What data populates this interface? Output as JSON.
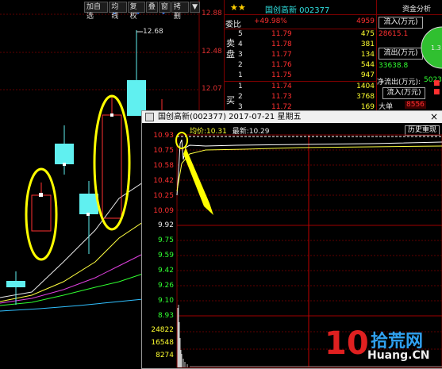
{
  "toolbar": {
    "items": [
      "加自选",
      "均线",
      "复权",
      "叠",
      "窗",
      "拷删"
    ],
    "arrow": "▼"
  },
  "main_chart": {
    "y_labels": [
      "12.88",
      "12.48",
      "12.07"
    ],
    "high_label": "12.68"
  },
  "quote": {
    "stock_name": "国创高新 002377",
    "fund_tab": "资金分析",
    "webi_label": "委比",
    "webi_value": "+49.98%",
    "webi_diff": "4959",
    "sell_side_label": "卖盘",
    "buy_side_label": "买",
    "sell_rows": [
      {
        "lvl": "5",
        "price": "11.79",
        "vol": "475"
      },
      {
        "lvl": "4",
        "price": "11.78",
        "vol": "381"
      },
      {
        "lvl": "3",
        "price": "11.77",
        "vol": "134"
      },
      {
        "lvl": "2",
        "price": "11.76",
        "vol": "544"
      },
      {
        "lvl": "1",
        "price": "11.75",
        "vol": "947"
      }
    ],
    "buy_rows": [
      {
        "lvl": "1",
        "price": "11.74",
        "vol": "1404"
      },
      {
        "lvl": "2",
        "price": "11.73",
        "vol": "3768"
      },
      {
        "lvl": "3",
        "price": "11.72",
        "vol": "169"
      }
    ],
    "inflow_label": "流入(万元)",
    "inflow_value": "28615.1",
    "outflow_label": "流出(万元)",
    "outflow_value": "33638.8",
    "net_label": "净流出(万元):",
    "net_value": "5023.7",
    "inflow2_label": "流入(万元)",
    "big_label": "大单",
    "big_value": "8556",
    "pie_value": "1.3"
  },
  "popup": {
    "title": "国创高新(002377)   2017-07-21 星期五",
    "avg_label": "均价:",
    "avg_value": "10.31",
    "latest_label": "最新:",
    "latest_value": "10.29",
    "history_button": "历史重现",
    "y_ticks": [
      "10.93",
      "10.75",
      "10.58",
      "10.42",
      "10.25",
      "10.09",
      "9.92",
      "9.75",
      "9.59",
      "9.42",
      "9.26",
      "9.10",
      "8.93"
    ],
    "vol_ticks": [
      "24822",
      "16548",
      "8274"
    ]
  },
  "watermark": {
    "number": "10",
    "brand": "拾荒网",
    "domain": "Huang.CN"
  },
  "colors": {
    "up": "#ff3030",
    "candle_up": "#60f0f0",
    "grid": "#800000",
    "highlight": "#ffff00"
  }
}
